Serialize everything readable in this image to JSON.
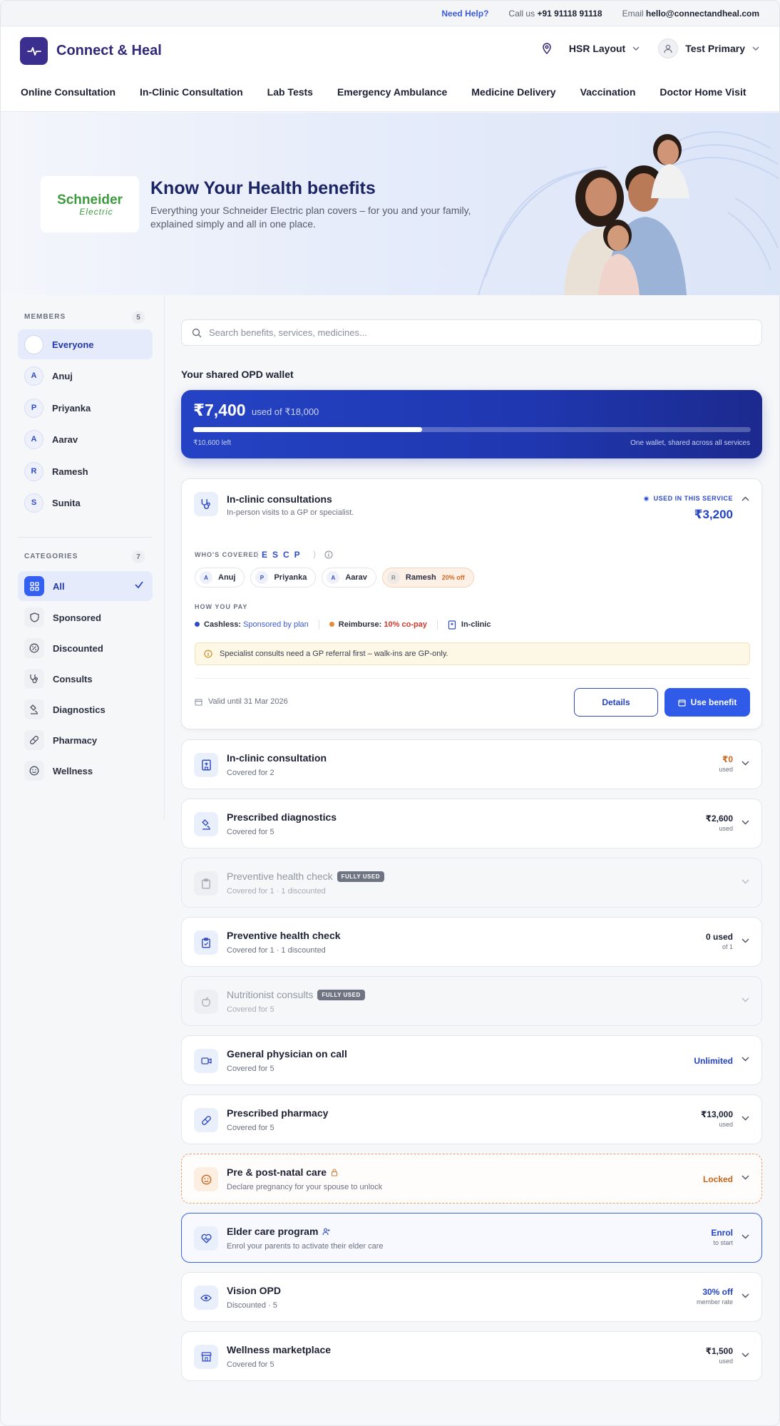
{
  "topbar": {
    "help": "Need Help?",
    "call_prefix": "Call us",
    "call_number": "+91 91118 91118",
    "email_prefix": "Email",
    "email": "hello@connectandheal.com"
  },
  "header": {
    "brand": "Connect & Heal",
    "location": "HSR Layout",
    "user": "Test Primary"
  },
  "nav": [
    "Online Consultation",
    "In-Clinic Consultation",
    "Lab Tests",
    "Emergency Ambulance",
    "Medicine Delivery",
    "Vaccination",
    "Doctor Home Visit"
  ],
  "hero": {
    "employer_line1": "Schneider",
    "employer_line2": "Electric",
    "title": "Know Your Health benefits",
    "subtitle": "Everything your Schneider Electric plan covers – for you and your family, explained simply and all in one place."
  },
  "sidebar": {
    "members_label": "MEMBERS",
    "members_count": "5",
    "members": [
      {
        "initial": "",
        "name": "Everyone"
      },
      {
        "initial": "A",
        "name": "Anuj"
      },
      {
        "initial": "P",
        "name": "Priyanka"
      },
      {
        "initial": "A",
        "name": "Aarav"
      },
      {
        "initial": "R",
        "name": "Ramesh"
      },
      {
        "initial": "S",
        "name": "Sunita"
      }
    ],
    "categories_label": "CATEGORIES",
    "categories_count": "7",
    "categories": [
      "All",
      "Sponsored",
      "Discounted",
      "Consults",
      "Diagnostics",
      "Pharmacy",
      "Wellness"
    ]
  },
  "search": {
    "placeholder": "Search benefits, services, medicines..."
  },
  "wallet": {
    "title": "Your shared OPD wallet",
    "amount": "₹7,400",
    "of_text": "used of ₹18,000",
    "used": 7400,
    "total": 18000,
    "left_text": "₹10,600 left",
    "shared_text": "One wallet, shared across all services"
  },
  "expanded": {
    "title": "In-clinic consultations",
    "subtitle": "In-person visits to a GP or specialist.",
    "used_label": "USED IN THIS SERVICE",
    "used_amount": "₹3,200",
    "covered_label": "WHO'S COVERED",
    "codes": "ESCP",
    "members": [
      {
        "initial": "A",
        "name": "Anuj"
      },
      {
        "initial": "P",
        "name": "Priyanka"
      },
      {
        "initial": "A",
        "name": "Aarav"
      },
      {
        "initial": "R",
        "name": "Ramesh",
        "tag": "20% off"
      }
    ],
    "pay_label": "HOW YOU PAY",
    "cashless_label": "Cashless:",
    "cashless_value": "Sponsored by plan",
    "reimburse_label": "Reimburse:",
    "reimburse_value": "10% co-pay",
    "mode": "In-clinic",
    "notice": "Specialist consults need a GP referral first – walk-ins are GP-only.",
    "valid": "Valid until 31 Mar 2026",
    "details_label": "Details",
    "use_label": "Use benefit"
  },
  "rows": [
    {
      "title": "In-clinic consultation",
      "sub": "Covered for 2",
      "value": "₹0",
      "note": "used",
      "style": "normal",
      "val_style": "orange-val"
    },
    {
      "title": "Prescribed diagnostics",
      "sub": "Covered for 5",
      "value": "₹2,600",
      "note": "used",
      "style": "normal"
    },
    {
      "title": "Preventive health check",
      "sub": "Covered for 1 · 1 discounted",
      "value": "",
      "note": "",
      "style": "muted",
      "badge": "FULLY USED"
    },
    {
      "title": "Preventive health check",
      "sub": "Covered for 1 · 1 discounted",
      "value": "0 used",
      "note": "of 1",
      "style": "normal"
    },
    {
      "title": "Nutritionist consults",
      "sub": "Covered for 5",
      "value": "",
      "note": "",
      "style": "muted",
      "badge": "FULLY USED"
    },
    {
      "title": "General physician on call",
      "sub": "Covered for 5",
      "value": "Unlimited",
      "note": "",
      "style": "normal",
      "val_style": "blue-val"
    },
    {
      "title": "Prescribed pharmacy",
      "sub": "Covered for 5",
      "value": "₹13,000",
      "note": "used",
      "style": "normal"
    },
    {
      "title": "Pre & post-natal care",
      "sub": "Declare pregnancy for your spouse to unlock",
      "value": "Locked",
      "note": "",
      "style": "locked",
      "val_style": "orange-val"
    },
    {
      "title": "Elder care program",
      "sub": "Enrol your parents to activate their elder care",
      "value": "Enrol",
      "note": "to start",
      "style": "enrol",
      "val_style": "blue-val"
    },
    {
      "title": "Vision OPD",
      "sub": "Discounted · 5",
      "value": "30% off",
      "note": "member rate",
      "style": "normal",
      "val_style": "blue-val"
    },
    {
      "title": "Wellness marketplace",
      "sub": "Covered for 5",
      "value": "₹1,500",
      "note": "used",
      "style": "normal"
    }
  ]
}
